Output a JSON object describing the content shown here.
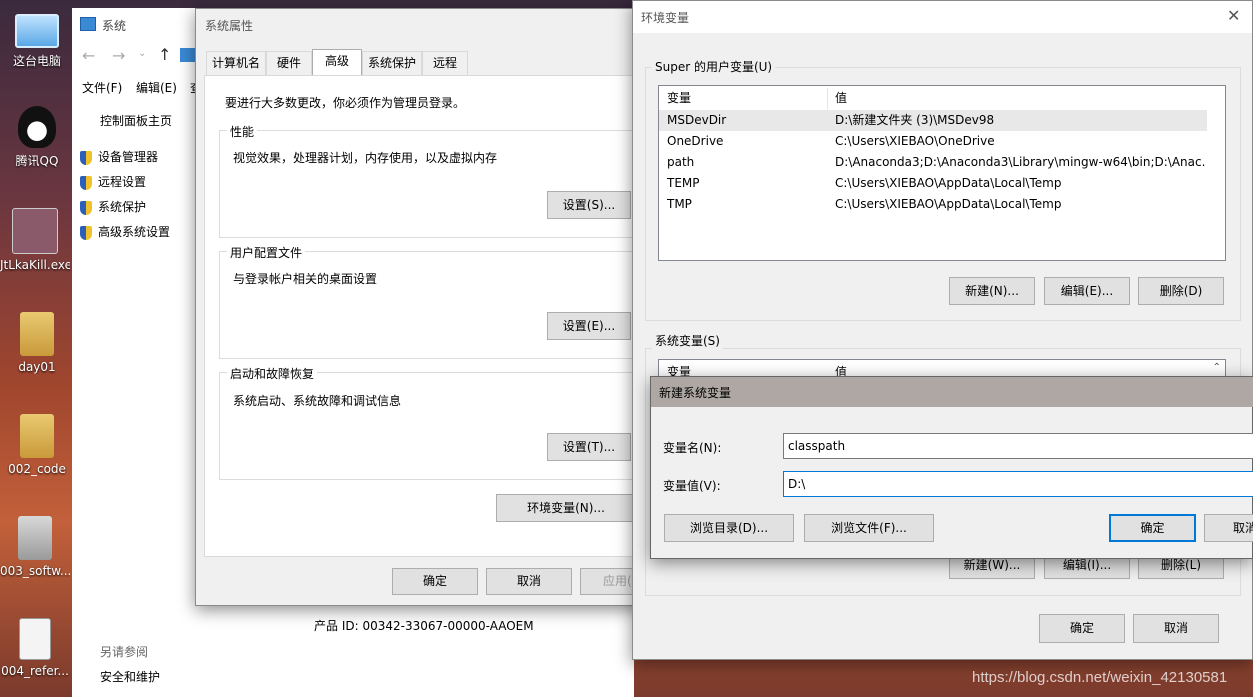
{
  "desktop": {
    "icons": [
      {
        "label": "这台电脑"
      },
      {
        "label": "腾讯QQ"
      },
      {
        "label": "JtLkaKill.exe"
      },
      {
        "label": "day01"
      },
      {
        "label": "002_code"
      },
      {
        "label": "003_softw..."
      },
      {
        "label": "004_refer..."
      }
    ]
  },
  "system_window": {
    "title": "系统",
    "menu": [
      "文件(F)",
      "编辑(E)",
      "查"
    ],
    "sidebar_home": "控制面板主页",
    "sidebar_items": [
      "设备管理器",
      "远程设置",
      "系统保护",
      "高级系统设置"
    ],
    "see_also": "另请参阅",
    "see_also_item": "安全和维护",
    "product_id": "产品 ID: 00342-33067-00000-AAOEM"
  },
  "sysprops": {
    "title": "系统属性",
    "tabs": [
      "计算机名",
      "硬件",
      "高级",
      "系统保护",
      "远程"
    ],
    "admin_note": "要进行大多数更改，你必须作为管理员登录。",
    "perf_label": "性能",
    "perf_desc": "视觉效果，处理器计划，内存使用，以及虚拟内存",
    "perf_button": "设置(S)...",
    "profile_label": "用户配置文件",
    "profile_desc": "与登录帐户相关的桌面设置",
    "profile_button": "设置(E)...",
    "startup_label": "启动和故障恢复",
    "startup_desc": "系统启动、系统故障和调试信息",
    "startup_button": "设置(T)...",
    "env_button": "环境变量(N)...",
    "ok": "确定",
    "cancel": "取消",
    "apply": "应用("
  },
  "envvars": {
    "title": "环境变量",
    "user_group": "Super 的用户变量(U)",
    "col_var": "变量",
    "col_val": "值",
    "user_vars": [
      {
        "name": "MSDevDir",
        "value": "D:\\新建文件夹 (3)\\MSDev98"
      },
      {
        "name": "OneDrive",
        "value": "C:\\Users\\XIEBAO\\OneDrive"
      },
      {
        "name": "path",
        "value": "D:\\Anaconda3;D:\\Anaconda3\\Library\\mingw-w64\\bin;D:\\Anac..."
      },
      {
        "name": "TEMP",
        "value": "C:\\Users\\XIEBAO\\AppData\\Local\\Temp"
      },
      {
        "name": "TMP",
        "value": "C:\\Users\\XIEBAO\\AppData\\Local\\Temp"
      }
    ],
    "user_new": "新建(N)...",
    "user_edit": "编辑(E)...",
    "user_delete": "删除(D)",
    "sys_group": "系统变量(S)",
    "sys_new": "新建(W)...",
    "sys_edit": "编辑(I)...",
    "sys_delete": "删除(L)",
    "ok": "确定",
    "cancel": "取消"
  },
  "newvar": {
    "title": "新建系统变量",
    "name_label": "变量名(N):",
    "name_value": "classpath",
    "value_label": "变量值(V):",
    "value_value": "D:\\",
    "browse_dir": "浏览目录(D)...",
    "browse_file": "浏览文件(F)...",
    "ok": "确定",
    "cancel": "取消"
  },
  "watermark": "https://blog.csdn.net/weixin_42130581"
}
